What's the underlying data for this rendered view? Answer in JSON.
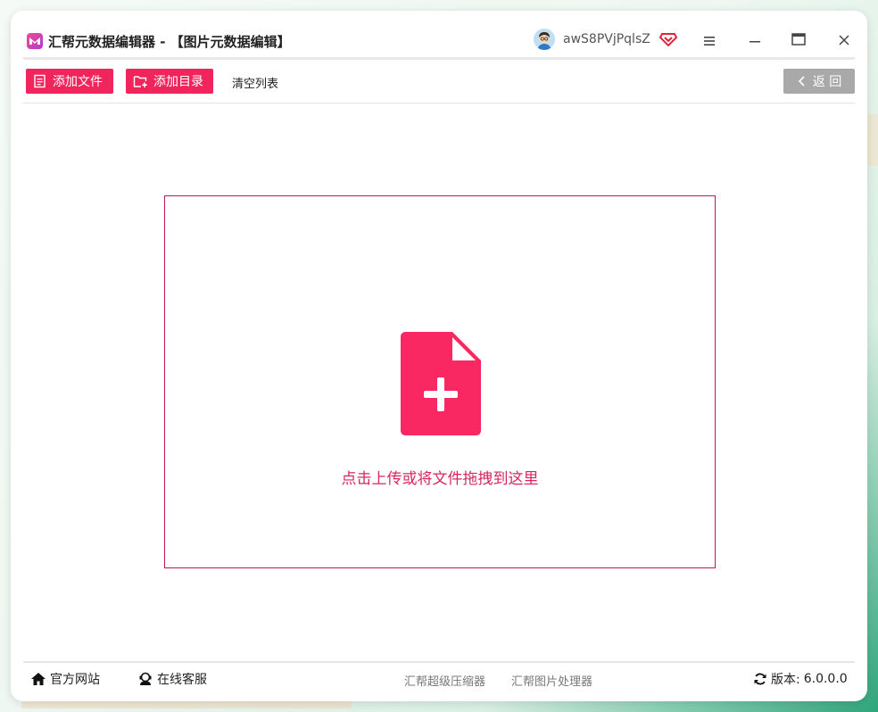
{
  "window": {
    "app_title": "汇帮元数据编辑器 - 【图片元数据编辑】",
    "username": "awS8PVjPqlsZ"
  },
  "toolbar": {
    "add_file_label": "添加文件",
    "add_dir_label": "添加目录",
    "clear_label": "清空列表",
    "back_label": "返 回"
  },
  "dropzone": {
    "hint": "点击上传或将文件拖拽到这里"
  },
  "footer": {
    "official_site": "官方网站",
    "online_service": "在线客服",
    "link_compressor": "汇帮超级压缩器",
    "link_image_processor": "汇帮图片处理器",
    "version_label": "版本:",
    "version_value": "6.0.0.0"
  },
  "colors": {
    "accent": "#f2245c",
    "dropzone_border": "#c2185b",
    "hint_text": "#d6285e",
    "back_button": "#a9a9a9"
  },
  "icons": [
    "app-logo-icon",
    "avatar-icon",
    "vip-icon",
    "menu-icon",
    "minimize-icon",
    "maximize-icon",
    "close-icon",
    "add-file-icon",
    "add-folder-icon",
    "chevron-left-icon",
    "file-plus-icon",
    "home-icon",
    "support-icon",
    "refresh-icon"
  ]
}
